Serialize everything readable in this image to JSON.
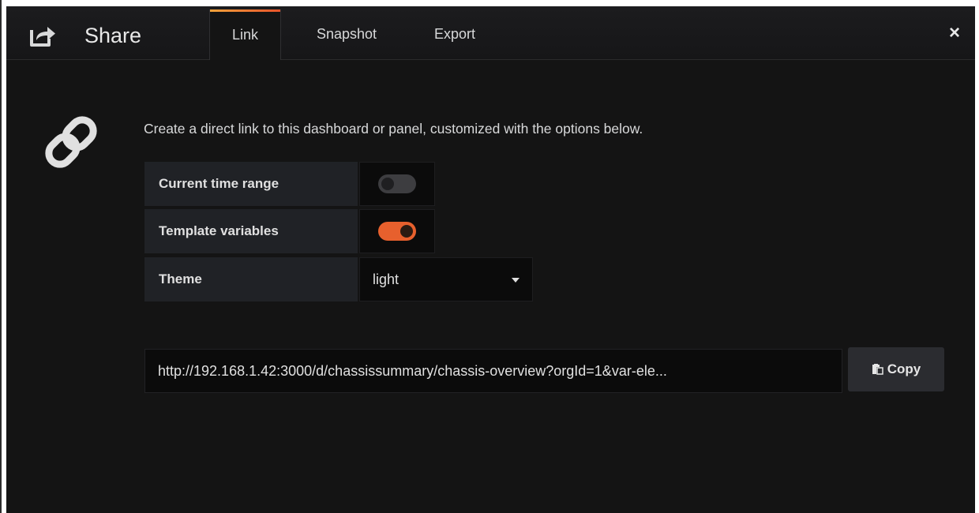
{
  "header": {
    "title": "Share",
    "icon": "share-icon",
    "close_icon": "close-icon",
    "close_label": "×"
  },
  "tabs": [
    {
      "label": "Link",
      "active": true
    },
    {
      "label": "Snapshot",
      "active": false
    },
    {
      "label": "Export",
      "active": false
    }
  ],
  "accent_color": "#e7602d",
  "body": {
    "icon": "link-icon",
    "description": "Create a direct link to this dashboard or panel, customized with the options below."
  },
  "options": {
    "time_range": {
      "label": "Current time range",
      "enabled": false
    },
    "template_vars": {
      "label": "Template variables",
      "enabled": true
    },
    "theme": {
      "label": "Theme",
      "value": "light"
    }
  },
  "share": {
    "url": "http://192.168.1.42:3000/d/chassissummary/chassis-overview?orgId=1&var-ele...",
    "copy_label": "Copy",
    "copy_icon": "clipboard-icon"
  }
}
